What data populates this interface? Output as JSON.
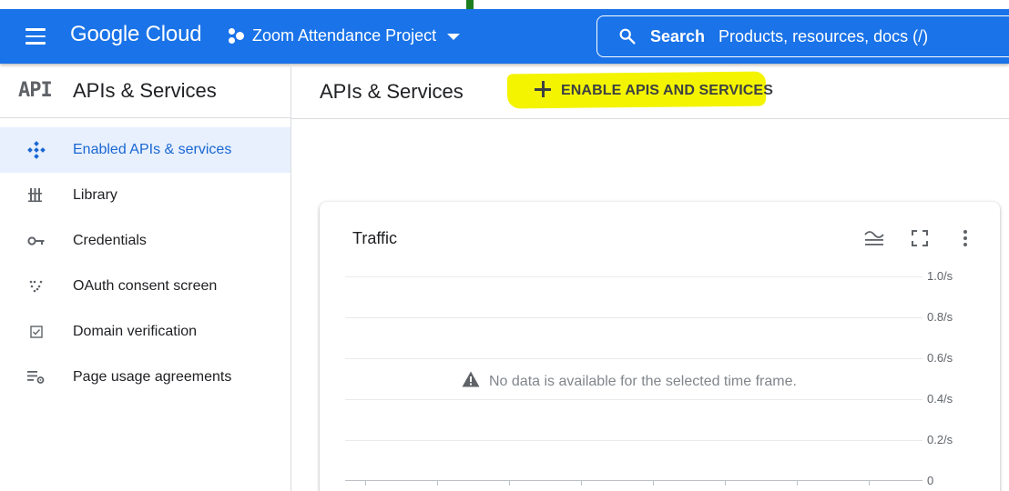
{
  "header": {
    "logo": "Google Cloud",
    "project": "Zoom Attendance Project",
    "search_label": "Search",
    "search_placeholder": "Products, resources, docs (/)",
    "menu_icon": "hamburger-menu-icon",
    "search_icon": "search-icon",
    "accent_color": "#1a73e8"
  },
  "sidebar": {
    "badge": "API",
    "title": "APIs & Services",
    "items": [
      {
        "label": "Enabled APIs & services",
        "icon": "enabled-apis-icon",
        "active": true
      },
      {
        "label": "Library",
        "icon": "library-icon",
        "active": false
      },
      {
        "label": "Credentials",
        "icon": "key-icon",
        "active": false
      },
      {
        "label": "OAuth consent screen",
        "icon": "oauth-consent-icon",
        "active": false
      },
      {
        "label": "Domain verification",
        "icon": "checkbox-icon",
        "active": false
      },
      {
        "label": "Page usage agreements",
        "icon": "settings-list-icon",
        "active": false
      }
    ]
  },
  "main": {
    "title": "APIs & Services",
    "enable_button": "ENABLE APIS AND SERVICES",
    "highlight_color": "#f4f400"
  },
  "traffic_card": {
    "title": "Traffic",
    "no_data_message": "No data is available for the selected time frame.",
    "tools": [
      "legend-toggle-icon",
      "fullscreen-icon",
      "more-vert-icon"
    ],
    "y_ticks": [
      "1.0/s",
      "0.8/s",
      "0.6/s",
      "0.4/s",
      "0.2/s",
      "0"
    ]
  }
}
